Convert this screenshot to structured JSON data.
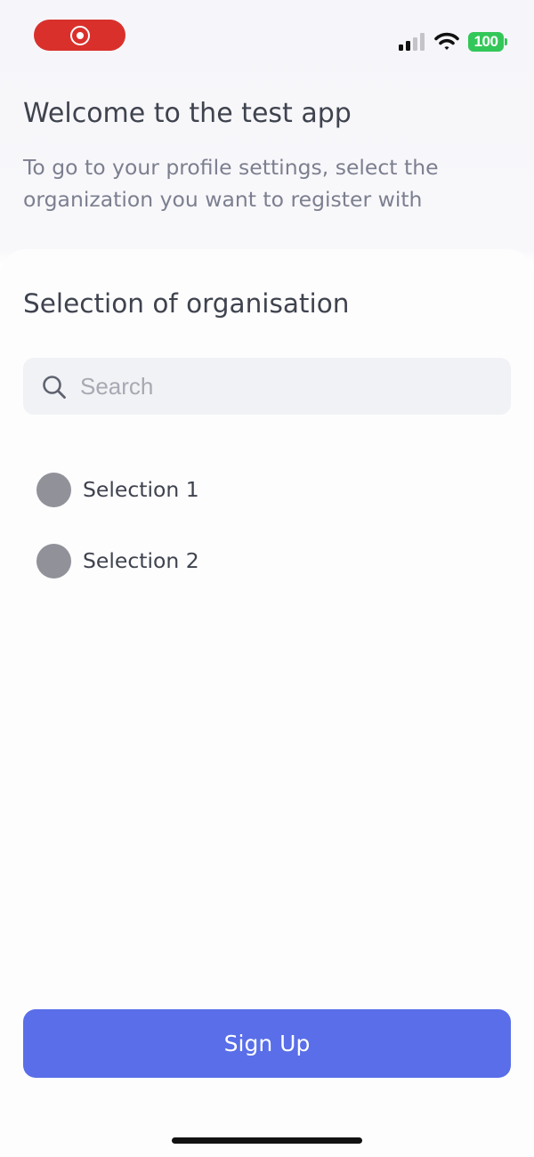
{
  "header": {
    "title": "Welcome to the test app",
    "subtitle": "To go to your profile settings, select the organization you want to register with"
  },
  "status_bar": {
    "battery_level": "100",
    "battery_color": "#33c759",
    "recording_color": "#d9302c",
    "icons": [
      "record-icon",
      "cellular-signal-icon",
      "wifi-icon",
      "battery-icon"
    ]
  },
  "selection": {
    "title": "Selection of organisation",
    "search": {
      "placeholder": "Search",
      "value": ""
    },
    "options": [
      {
        "label": "Selection 1",
        "selected": false
      },
      {
        "label": "Selection 2",
        "selected": false
      }
    ]
  },
  "actions": {
    "signup_label": "Sign Up",
    "signup_color": "#596ee8"
  }
}
